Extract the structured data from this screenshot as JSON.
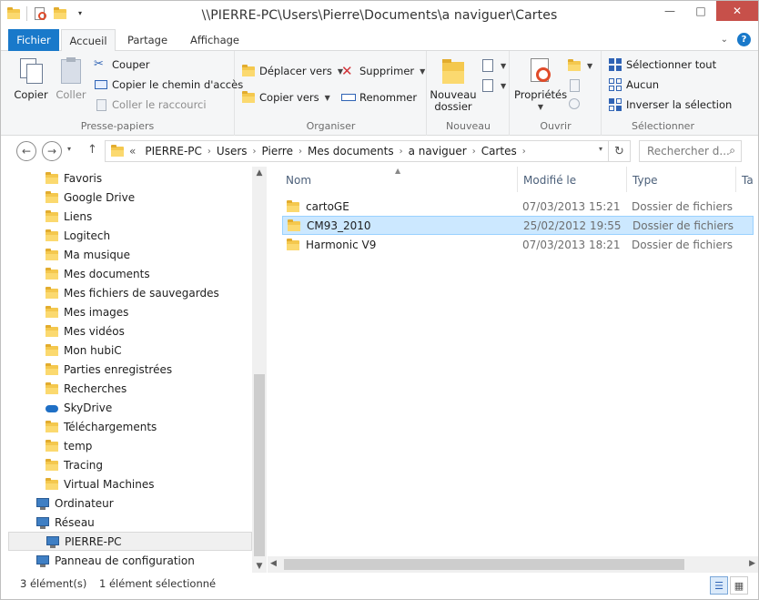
{
  "window": {
    "title": "\\\\PIERRE-PC\\Users\\Pierre\\Documents\\a naviguer\\Cartes",
    "minimize": "—",
    "maximize": "□",
    "close": "✕"
  },
  "tabs": {
    "file": "Fichier",
    "home": "Accueil",
    "share": "Partage",
    "view": "Affichage"
  },
  "ribbon": {
    "clipboard": {
      "label": "Presse-papiers",
      "copy": "Copier",
      "paste": "Coller",
      "cut": "Couper",
      "copy_path": "Copier le chemin d'accès",
      "paste_shortcut": "Coller le raccourci"
    },
    "organize": {
      "label": "Organiser",
      "move_to": "Déplacer vers",
      "copy_to": "Copier vers",
      "delete": "Supprimer",
      "rename": "Renommer"
    },
    "new": {
      "label": "Nouveau",
      "new_folder_line1": "Nouveau",
      "new_folder_line2": "dossier"
    },
    "open": {
      "label": "Ouvrir",
      "properties": "Propriétés"
    },
    "select": {
      "label": "Sélectionner",
      "select_all": "Sélectionner tout",
      "select_none": "Aucun",
      "invert": "Inverser la sélection"
    }
  },
  "address": {
    "prefix": "«",
    "crumbs": [
      "PIERRE-PC",
      "Users",
      "Pierre",
      "Mes documents",
      "a naviguer",
      "Cartes"
    ],
    "search_placeholder": "Rechercher d..."
  },
  "nav": {
    "items": [
      {
        "label": "Favoris",
        "icon": "favorites-folder-icon"
      },
      {
        "label": "Google Drive",
        "icon": "google-drive-icon"
      },
      {
        "label": "Liens",
        "icon": "links-folder-icon"
      },
      {
        "label": "Logitech",
        "icon": "folder-icon"
      },
      {
        "label": "Ma musique",
        "icon": "music-folder-icon"
      },
      {
        "label": "Mes documents",
        "icon": "documents-folder-icon"
      },
      {
        "label": "Mes fichiers de sauvegardes",
        "icon": "folder-icon"
      },
      {
        "label": "Mes images",
        "icon": "pictures-folder-icon"
      },
      {
        "label": "Mes vidéos",
        "icon": "videos-folder-icon"
      },
      {
        "label": "Mon hubiC",
        "icon": "folder-icon"
      },
      {
        "label": "Parties enregistrées",
        "icon": "saved-games-icon"
      },
      {
        "label": "Recherches",
        "icon": "searches-folder-icon"
      },
      {
        "label": "SkyDrive",
        "icon": "skydrive-cloud-icon"
      },
      {
        "label": "Téléchargements",
        "icon": "downloads-folder-icon"
      },
      {
        "label": "temp",
        "icon": "folder-icon"
      },
      {
        "label": "Tracing",
        "icon": "folder-icon"
      },
      {
        "label": "Virtual Machines",
        "icon": "folder-icon"
      },
      {
        "label": "Ordinateur",
        "icon": "computer-icon"
      },
      {
        "label": "Réseau",
        "icon": "network-icon"
      },
      {
        "label": "PIERRE-PC",
        "icon": "network-computer-icon"
      },
      {
        "label": "Panneau de configuration",
        "icon": "control-panel-icon"
      }
    ]
  },
  "columns": {
    "name": "Nom",
    "modified": "Modifié le",
    "type": "Type",
    "size": "Ta"
  },
  "files": [
    {
      "name": "cartoGE",
      "modified": "07/03/2013 15:21",
      "type": "Dossier de fichiers"
    },
    {
      "name": "CM93_2010",
      "modified": "25/02/2012 19:55",
      "type": "Dossier de fichiers"
    },
    {
      "name": "Harmonic V9",
      "modified": "07/03/2013 18:21",
      "type": "Dossier de fichiers"
    }
  ],
  "status": {
    "count": "3 élément(s)",
    "selection": "1 élément sélectionné"
  },
  "colors": {
    "file_tab": "#1979ca",
    "selection": "#cce8ff",
    "folder": "#f4c84e"
  }
}
